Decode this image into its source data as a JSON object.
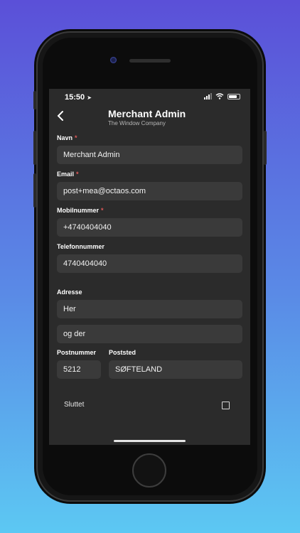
{
  "status": {
    "time": "15:50"
  },
  "nav": {
    "title": "Merchant Admin",
    "subtitle": "The Window Company"
  },
  "form": {
    "navn": {
      "label": "Navn",
      "value": "Merchant Admin",
      "required_mark": "*"
    },
    "email": {
      "label": "Email",
      "value": "post+mea@octaos.com",
      "required_mark": "*"
    },
    "mobil": {
      "label": "Mobilnummer",
      "value": "+4740404040",
      "required_mark": "*"
    },
    "telefon": {
      "label": "Telefonnummer",
      "value": "4740404040"
    },
    "adresse": {
      "label": "Adresse",
      "line1": "Her",
      "line2": "og der"
    },
    "postnummer": {
      "label": "Postnummer",
      "value": "5212"
    },
    "poststed": {
      "label": "Poststed",
      "value": "SØFTELAND"
    },
    "sluttet": {
      "label": "Sluttet",
      "checked": false
    }
  },
  "icons": {
    "back": "chevron-left-icon",
    "location": "location-arrow-icon",
    "signal": "signal-icon",
    "wifi": "wifi-icon",
    "battery": "battery-icon"
  },
  "colors": {
    "background_top": "#5b50d8",
    "background_bottom": "#5cc8f3",
    "screen": "#2b2b2b",
    "field": "#3a3a3a",
    "required": "#e05a5a"
  }
}
